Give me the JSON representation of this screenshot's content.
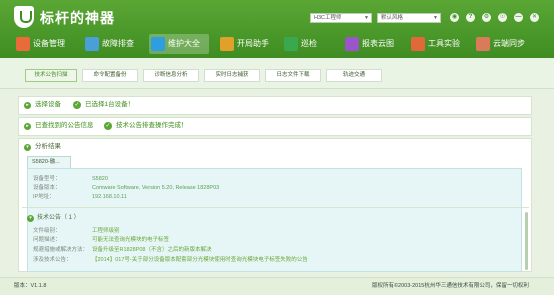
{
  "app": {
    "title": "标杆的神器"
  },
  "header": {
    "select_device": "H3C工程师",
    "select_mode": "默认风格",
    "window_buttons": [
      "◉",
      "?",
      "⚙",
      "☉",
      "—",
      "✕"
    ]
  },
  "nav": [
    {
      "label": "设备管理",
      "icon": "device-icon",
      "color": "#e96b3a"
    },
    {
      "label": "故障排查",
      "icon": "bug-icon",
      "color": "#4b9fd8"
    },
    {
      "label": "维护大全",
      "icon": "book-icon",
      "color": "#2e9ee0"
    },
    {
      "label": "开局助手",
      "icon": "rocket-icon",
      "color": "#e0a02a"
    },
    {
      "label": "巡检",
      "icon": "check-icon",
      "color": "#3aa84f"
    },
    {
      "label": "报表云图",
      "icon": "chart-icon",
      "color": "#9a55c8"
    },
    {
      "label": "工具实验",
      "icon": "tool-icon",
      "color": "#e2683a"
    },
    {
      "label": "云端同步",
      "icon": "cloud-icon",
      "color": "#d97a58"
    }
  ],
  "tabs": [
    "技术公告扫描",
    "命令配置备份",
    "诊断信息分析",
    "实时日志捕获",
    "日志文件下载",
    "轨迹交通"
  ],
  "rows": {
    "select_device": {
      "label": "选择设备",
      "status": "已选择1台设备！"
    },
    "found": {
      "label": "已查找到的公告信息",
      "status": "技术公告排查操作完成！"
    },
    "analysis": {
      "label": "分析结果"
    }
  },
  "device": {
    "tab": "S5820-融...",
    "fields": [
      {
        "k": "设备型号：",
        "v": "S5820"
      },
      {
        "k": "设备版本：",
        "v": "Comware Software, Version 5.20, Release 1828P03"
      },
      {
        "k": "IP地址：",
        "v": "192.168.10.11"
      }
    ],
    "bulletin_heading": "技术公告（ 1 ）",
    "bulletin": [
      {
        "k": "文件级别：",
        "v": "工程师级别"
      },
      {
        "k": "问题描述：",
        "v": "可能无法查询光模块的电子标签"
      },
      {
        "k": "规避措施或解决方法：",
        "v": "设备升级至R1828P08（不含）之后的新版本解决"
      },
      {
        "k": "涉及技术公告：",
        "v": "【2014】017号-关于部分设备版本配套部分光模块使用时查询光模块电子标签失败的公告"
      }
    ]
  },
  "footer": {
    "version": "版本：V1.1.8",
    "copyright": "版权所有©2003-2015杭州华三通信技术有限公司，保留一切权利"
  }
}
